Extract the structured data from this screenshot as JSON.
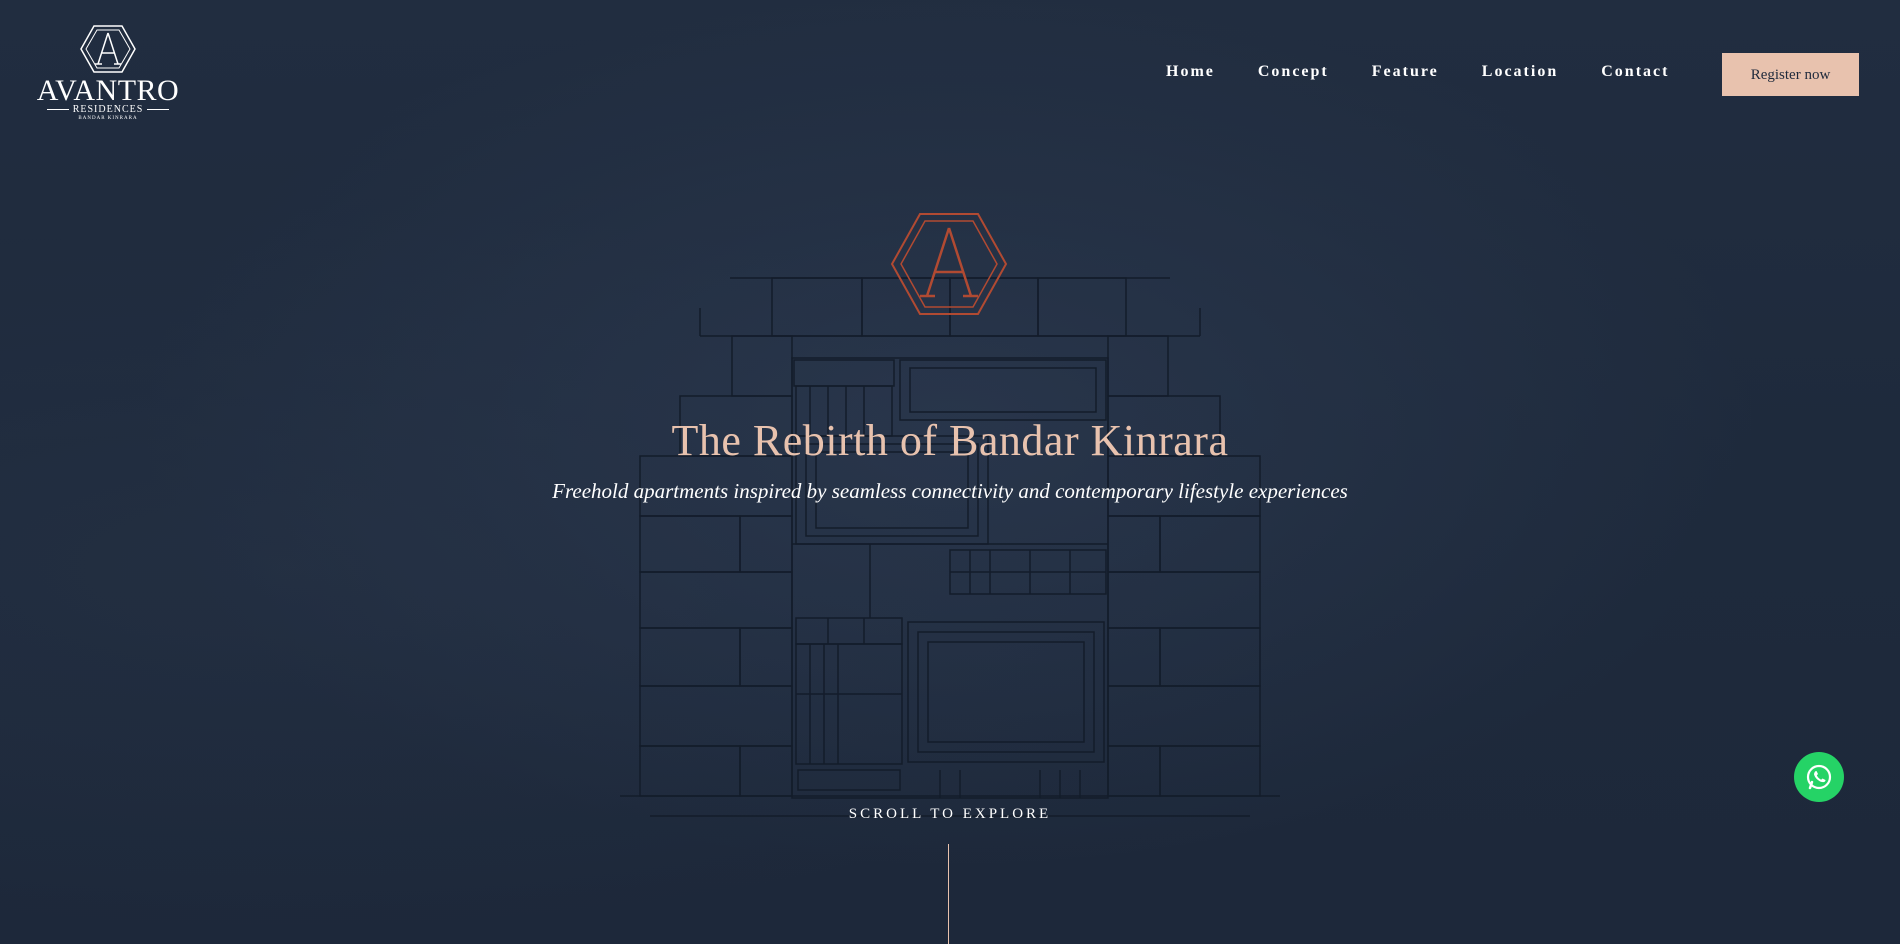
{
  "brand": {
    "name": "AVANTRO",
    "sub": "RESIDENCES",
    "sub2": "BANDAR KINRARA"
  },
  "nav": {
    "items": [
      "Home",
      "Concept",
      "Feature",
      "Location",
      "Contact"
    ],
    "register_label": "Register now"
  },
  "hero": {
    "title": "The Rebirth of Bandar Kinrara",
    "subtitle": "Freehold apartments inspired by seamless connectivity and contemporary lifestyle experiences",
    "scroll_label": "SCROLL TO EXPLORE"
  },
  "colors": {
    "background": "#1f2a3c",
    "accent": "#e8c2ae",
    "emblem": "#b14a32",
    "whatsapp": "#25d366"
  },
  "icons": {
    "logo": "avantro-hexagon-logo-icon",
    "emblem": "avantro-hexagon-emblem-icon",
    "whatsapp": "whatsapp-icon"
  }
}
